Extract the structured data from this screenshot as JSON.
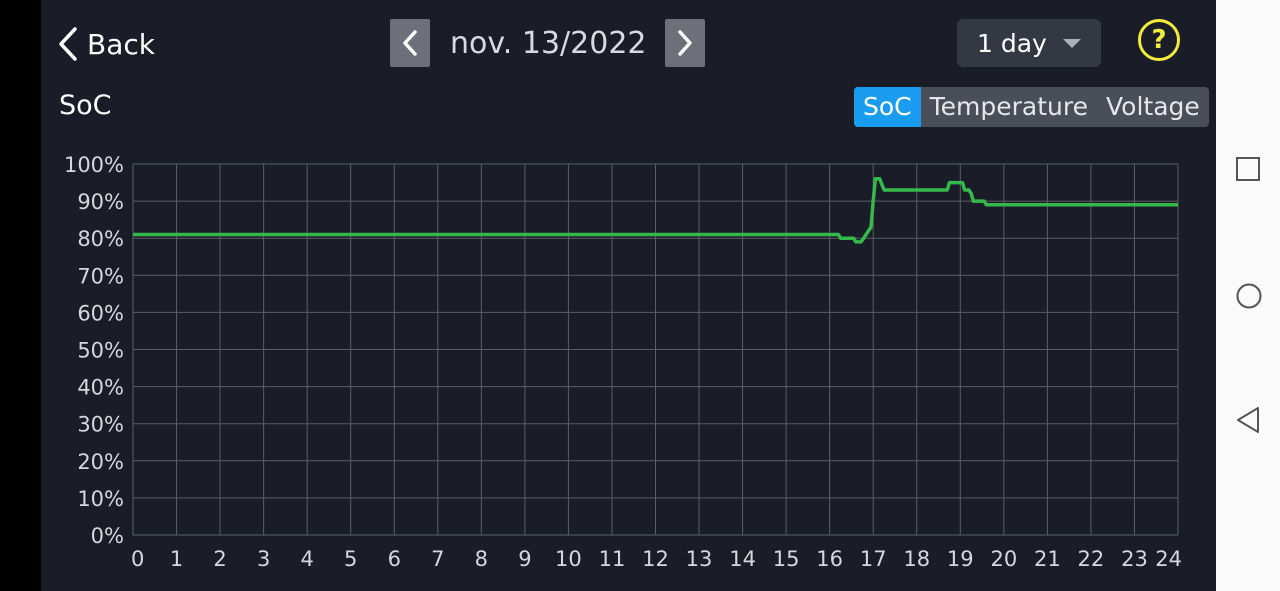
{
  "header": {
    "back_label": "Back",
    "date": "nov. 13/2022",
    "range": "1 day"
  },
  "section": {
    "title": "SoC"
  },
  "tabs": [
    {
      "label": "SoC",
      "active": true
    },
    {
      "label": "Temperature",
      "active": false
    },
    {
      "label": "Voltage",
      "active": false
    }
  ],
  "colors": {
    "background": "#1a1d28",
    "accent": "#1a9cf0",
    "series": "#34b94a",
    "grid": "#5a5e68",
    "help": "#f0ed3c"
  },
  "icons": {
    "back": "chevron-left-icon",
    "prev": "chevron-left-icon",
    "next": "chevron-right-icon",
    "dropdown": "caret-down-icon",
    "help": "question-circle-icon"
  },
  "chart_data": {
    "type": "line",
    "title": "",
    "xlabel": "",
    "ylabel": "",
    "xlim": [
      0,
      24
    ],
    "ylim": [
      0,
      100
    ],
    "grid": true,
    "x_ticks": [
      0,
      1,
      2,
      3,
      4,
      5,
      6,
      7,
      8,
      9,
      10,
      11,
      12,
      13,
      14,
      15,
      16,
      17,
      18,
      19,
      20,
      21,
      22,
      23,
      24
    ],
    "y_ticks": [
      "0%",
      "10%",
      "20%",
      "30%",
      "40%",
      "50%",
      "60%",
      "70%",
      "80%",
      "90%",
      "100%"
    ],
    "series": [
      {
        "color": "#34b94a",
        "points": [
          [
            0,
            81
          ],
          [
            16.2,
            81
          ],
          [
            16.25,
            80
          ],
          [
            16.55,
            80
          ],
          [
            16.6,
            79
          ],
          [
            16.72,
            79
          ],
          [
            16.78,
            80
          ],
          [
            16.95,
            83
          ],
          [
            17.0,
            90
          ],
          [
            17.05,
            96
          ],
          [
            17.15,
            96
          ],
          [
            17.25,
            93
          ],
          [
            18.7,
            93
          ],
          [
            18.75,
            95
          ],
          [
            19.05,
            95
          ],
          [
            19.1,
            93
          ],
          [
            19.2,
            93
          ],
          [
            19.25,
            92
          ],
          [
            19.3,
            90
          ],
          [
            19.55,
            90
          ],
          [
            19.6,
            89
          ],
          [
            24,
            89
          ]
        ]
      }
    ]
  },
  "system_nav": {
    "icons": [
      "square-icon",
      "circle-icon",
      "triangle-back-icon"
    ]
  }
}
